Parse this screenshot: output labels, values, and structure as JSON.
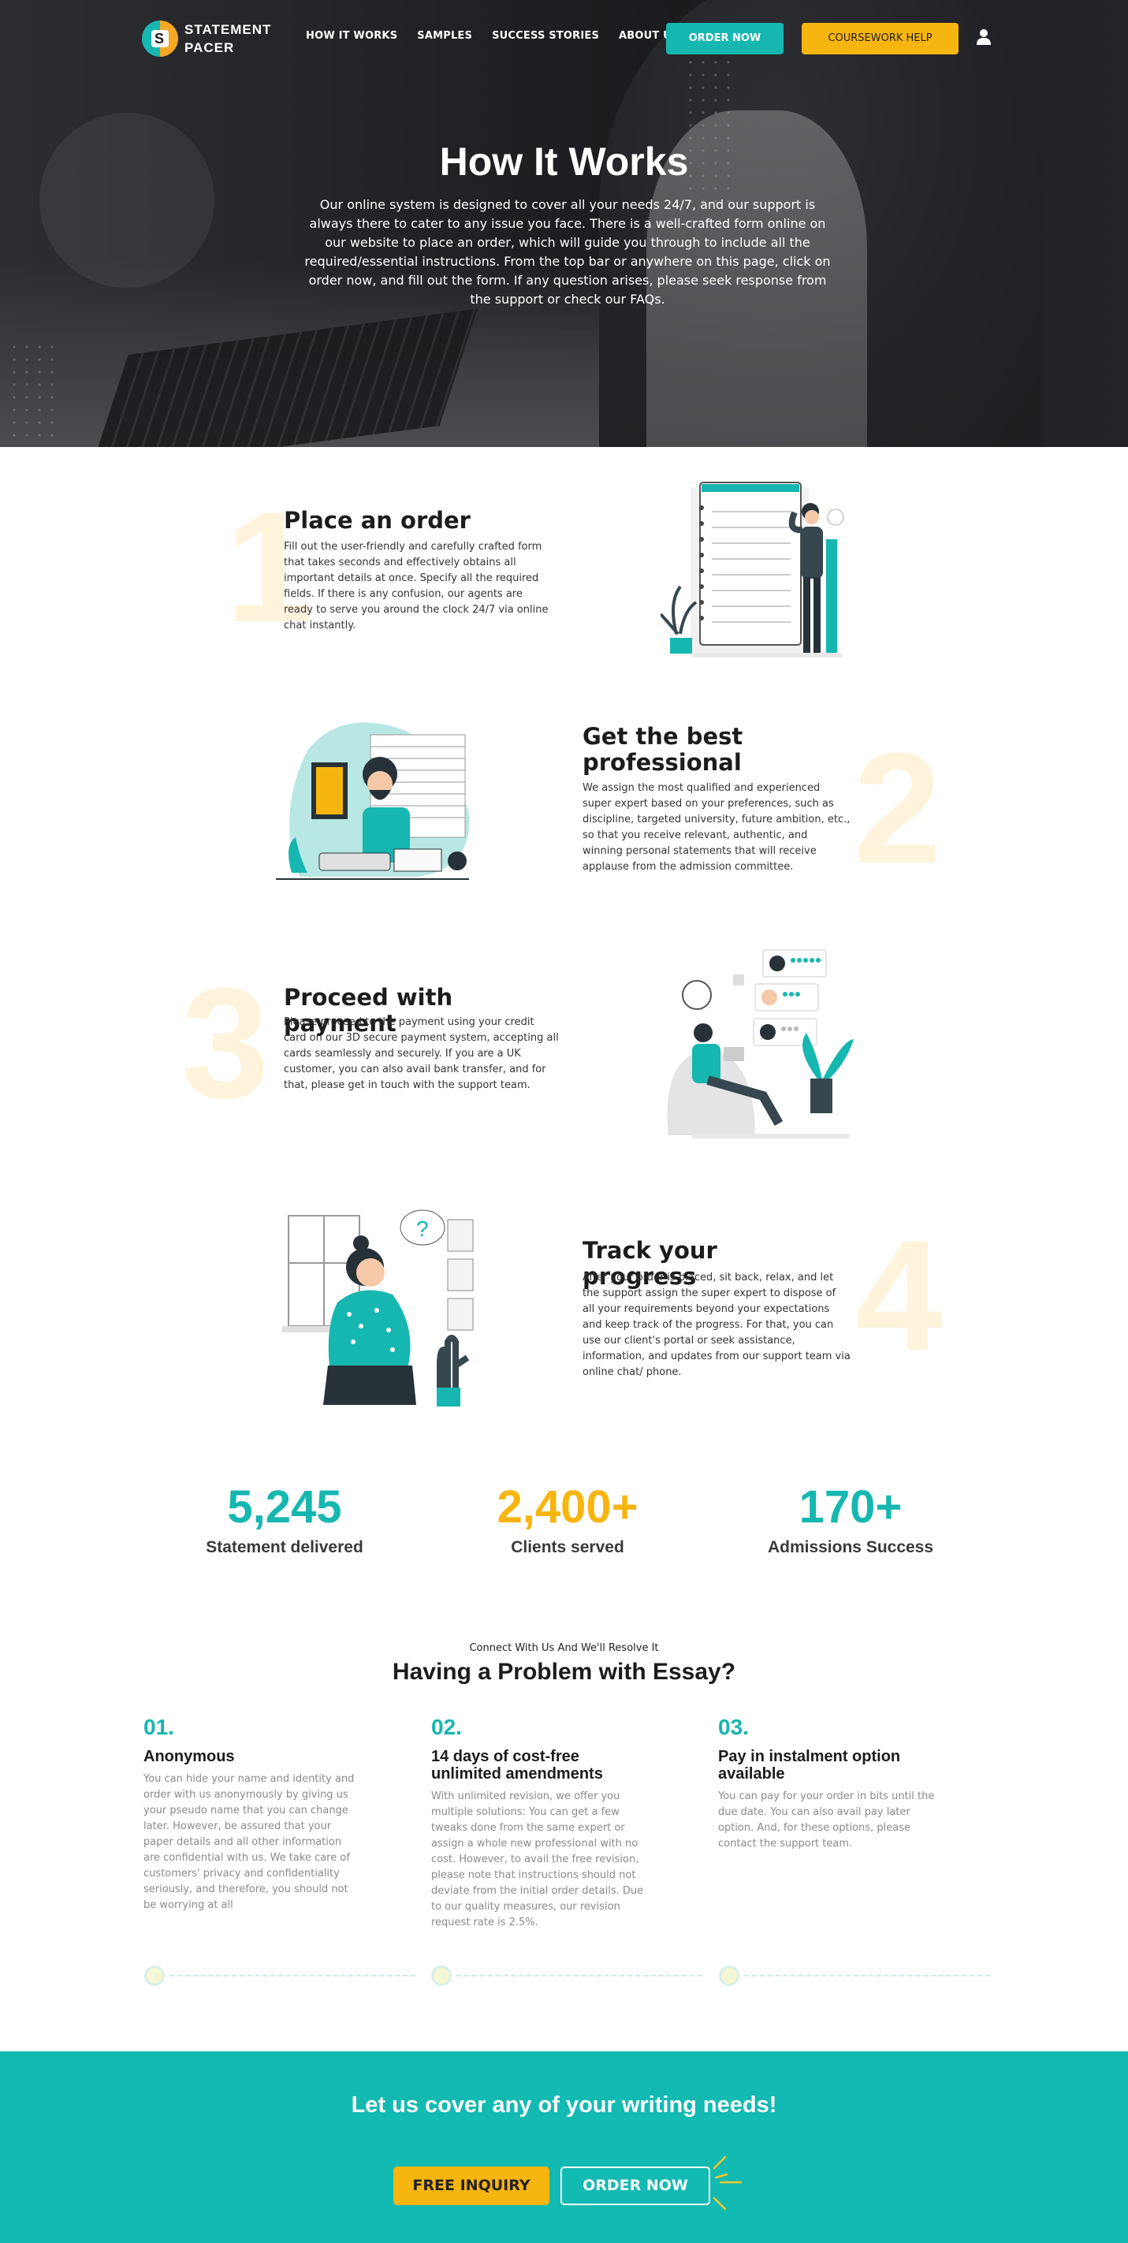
{
  "brand": {
    "name_line1": "STATEMENT",
    "name_line2": "PACER",
    "logo_letter": "S"
  },
  "nav": {
    "links": [
      "HOW IT WORKS",
      "SAMPLES",
      "SUCCESS STORIES",
      "ABOUT US"
    ],
    "order_now": "ORDER NOW",
    "coursework_help": "COURSEWORK HELP"
  },
  "hero": {
    "title": "How It Works",
    "text": "Our online system is designed to cover all your needs 24/7, and our support is always there to cater to any issue you face. There is a well-crafted form online on our website to place an order, which will guide you through to include all the required/essential instructions. From the top bar or anywhere on this page, click on order now, and fill out the form. If any question arises, please seek response from the support or check our FAQs."
  },
  "steps": [
    {
      "num": "1",
      "title": "Place an order",
      "text": "Fill out the user-friendly and carefully crafted form that takes seconds and effectively obtains all important details at once. Specify all the required fields. If there is any confusion, our agents are ready to serve you around the clock 24/7 via online chat instantly."
    },
    {
      "num": "2",
      "title": "Get the best professional",
      "text": "We assign the most qualified and experienced super expert based on your preferences, such as discipline, targeted university, future ambition, etc., so that you receive relevant, authentic, and winning personal statements that will receive applause from the admission committee."
    },
    {
      "num": "3",
      "title": "Proceed with payment",
      "text": "Please proceed to the payment using your credit card on our 3D secure payment system, accepting all cards seamlessly and securely. If you are a UK customer, you can also avail bank transfer, and for that, please get in touch with the support team."
    },
    {
      "num": "4",
      "title": "Track your progress",
      "text": "After your order is placed, sit back, relax, and let the support assign the super expert to dispose of all your requirements beyond your expectations and keep track of the progress. For that, you can use our client's portal or seek assistance, information, and updates from our support team via online chat/ phone."
    }
  ],
  "stats": [
    {
      "value": "5,245",
      "label": "Statement delivered",
      "color": "#15b7b0"
    },
    {
      "value": "2,400+",
      "label": "Clients served",
      "color": "#f7b50f"
    },
    {
      "value": "170+",
      "label": "Admissions Success",
      "color": "#15b7b0"
    }
  ],
  "problem": {
    "kicker": "Connect With Us And We'll Resolve It",
    "title": "Having a Problem with Essay?",
    "columns": [
      {
        "num": "01.",
        "title": "Anonymous",
        "text": "You can hide your name and identity and order with us anonymously by giving us your pseudo name that you can change later. However, be assured that your paper details and all other information are confidential with us. We take care of customers' privacy and confidentiality seriously, and therefore, you should not be worrying at all"
      },
      {
        "num": "02.",
        "title": "14 days of cost-free unlimited amendments",
        "text": "With unlimited revision, we offer you multiple solutions: You can get a few tweaks done from the same expert or assign a whole new professional with no cost. However, to avail the free revision, please note that instructions should not deviate from the initial order details. Due to our quality measures, our revision request rate is 2.5%."
      },
      {
        "num": "03.",
        "title": "Pay in instalment option available",
        "text": "You can pay for your order in bits until the due date. You can also avail pay later option. And, for these options, please contact the support team."
      }
    ]
  },
  "cta": {
    "title": "Let us cover any of your writing needs!",
    "free_inquiry": "FREE INQUIRY",
    "order_now": "ORDER NOW"
  },
  "colors": {
    "teal": "#15b7b0",
    "yellow": "#f7b50f",
    "step_number": "#fff3dc"
  },
  "icons": [
    "user-icon"
  ]
}
